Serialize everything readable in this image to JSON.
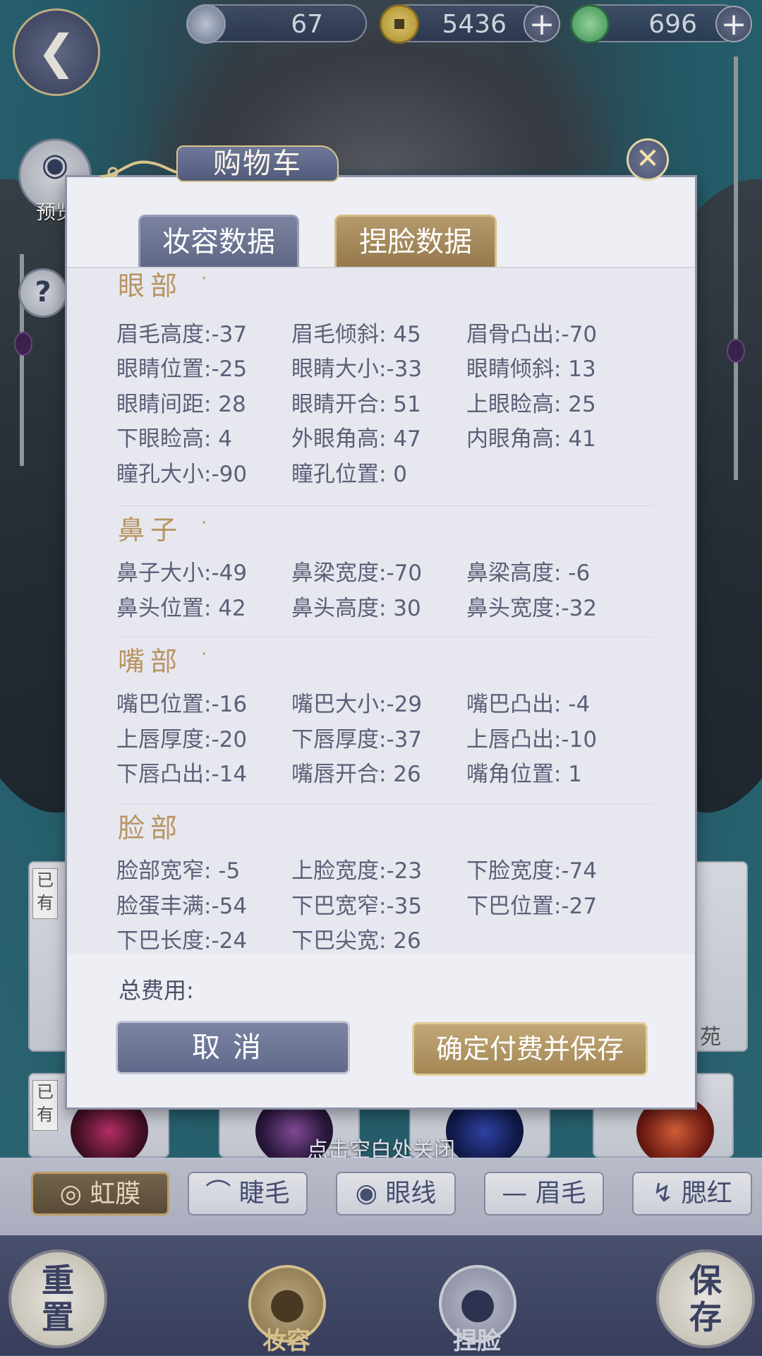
{
  "currency": [
    {
      "icon": "feather-coin-icon",
      "value": "67",
      "has_plus": false
    },
    {
      "icon": "copper-coin-icon",
      "value": "5436",
      "has_plus": true
    },
    {
      "icon": "jade-icon",
      "value": "696",
      "has_plus": true
    }
  ],
  "side": {
    "preview_label": "预览",
    "help_label": "?"
  },
  "modal": {
    "title": "购物车",
    "tabs": [
      "妆容数据",
      "捏脸数据"
    ],
    "active_tab": "捏脸数据",
    "sections": [
      {
        "title": "眼部",
        "dot": "·",
        "items": [
          "眉毛高度:-37",
          "眉毛倾斜: 45",
          "眉骨凸出:-70",
          "眼睛位置:-25",
          "眼睛大小:-33",
          "眼睛倾斜: 13",
          "眼睛间距: 28",
          "眼睛开合: 51",
          "上眼睑高: 25",
          "下眼睑高:  4",
          "外眼角高: 47",
          "内眼角高: 41",
          "瞳孔大小:-90",
          "瞳孔位置:  0"
        ]
      },
      {
        "title": "鼻子",
        "dot": "·",
        "items": [
          "鼻子大小:-49",
          "鼻梁宽度:-70",
          "鼻梁高度: -6",
          "鼻头位置: 42",
          "鼻头高度: 30",
          "鼻头宽度:-32"
        ]
      },
      {
        "title": "嘴部",
        "dot": "·",
        "items": [
          "嘴巴位置:-16",
          "嘴巴大小:-29",
          "嘴巴凸出: -4",
          "上唇厚度:-20",
          "下唇厚度:-37",
          "上唇凸出:-10",
          "下唇凸出:-14",
          "嘴唇开合: 26",
          "嘴角位置:  1"
        ]
      },
      {
        "title": "脸部",
        "dot": "",
        "items": [
          "脸部宽窄: -5",
          "上脸宽度:-23",
          "下脸宽度:-74",
          "脸蛋丰满:-54",
          "下巴宽窄:-35",
          "下巴位置:-27",
          "下巴长度:-24",
          "下巴尖宽: 26"
        ]
      }
    ],
    "fee_label": "总费用:",
    "cancel_label": "取消",
    "confirm_label": "确定付费并保存",
    "close_icon": "close-icon"
  },
  "hint": "点击空白处关闭",
  "categories": [
    {
      "label": "虹膜",
      "icon": "iris-icon",
      "active": true
    },
    {
      "label": "睫毛",
      "icon": "eyelash-icon",
      "active": false
    },
    {
      "label": "眼线",
      "icon": "eyeliner-icon",
      "active": false
    },
    {
      "label": "眉毛",
      "icon": "eyebrow-icon",
      "active": false
    },
    {
      "label": "腮红",
      "icon": "blush-icon",
      "active": false
    }
  ],
  "bottom": {
    "reset_label": "重置",
    "makeup_label": "妆容",
    "face_label": "捏脸",
    "save_label": "保存"
  },
  "grid_badges": [
    "已有",
    "已有"
  ],
  "grid_side_text": [
    "苑"
  ]
}
